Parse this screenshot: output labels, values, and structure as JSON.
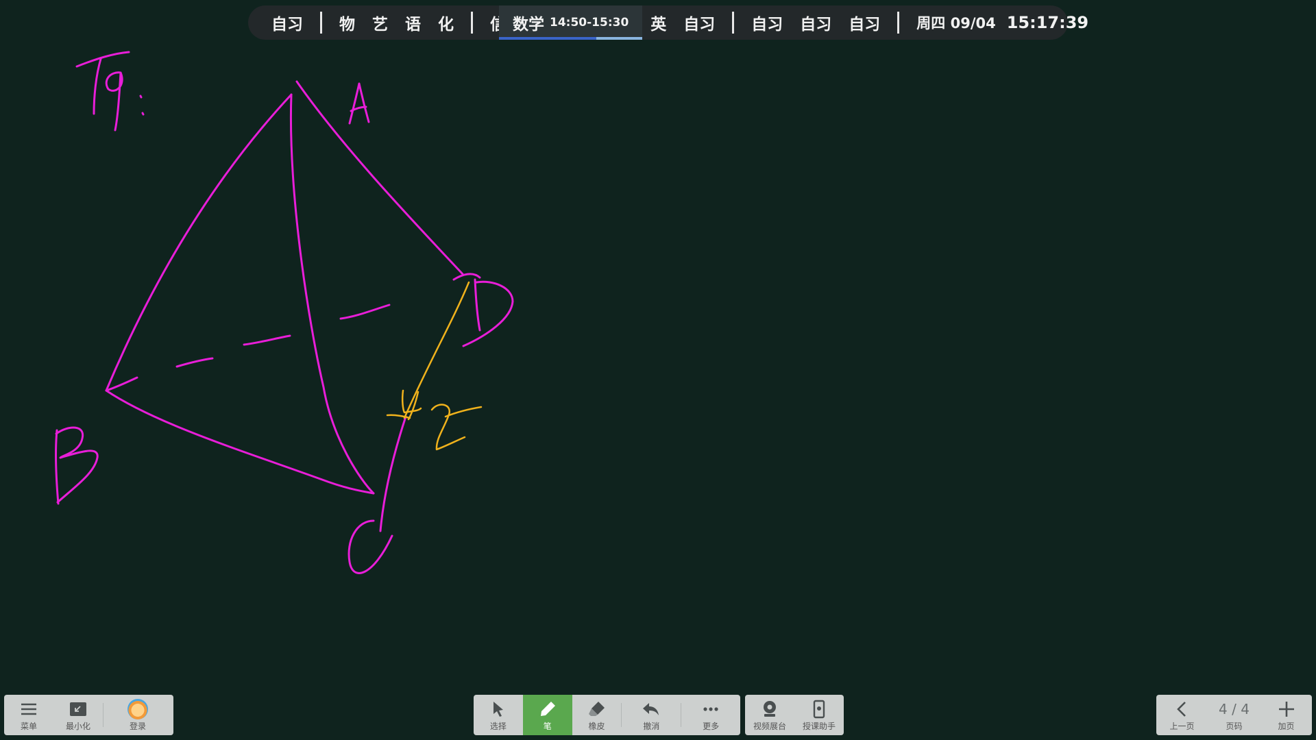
{
  "schedule": {
    "items_before": [
      "自习"
    ],
    "group1": [
      "物",
      "艺",
      "语",
      "化"
    ],
    "group2": [
      "信"
    ],
    "current": {
      "subject": "数学",
      "time": "14:50-15:30",
      "progress": 0.68
    },
    "group3": [
      "英",
      "自习"
    ],
    "group4": [
      "自习",
      "自习",
      "自习"
    ],
    "date": "周四 09/04",
    "clock": "15:17:39"
  },
  "canvas": {
    "ink_colors": {
      "magenta": "#e81ed8",
      "orange": "#f0b21c"
    },
    "handwriting": "T9: A B C D 42"
  },
  "left_toolbar": {
    "menu": {
      "label": "菜单",
      "icon": "hamburger-icon"
    },
    "minimize": {
      "label": "最小化",
      "icon": "minimize-icon"
    },
    "login": {
      "label": "登录",
      "icon": "avatar-icon"
    }
  },
  "center_toolbar": {
    "select": {
      "label": "选择",
      "icon": "cursor-arrow-icon"
    },
    "pen": {
      "label": "笔",
      "icon": "pen-icon"
    },
    "eraser": {
      "label": "橡皮",
      "icon": "eraser-icon"
    },
    "undo": {
      "label": "撤消",
      "icon": "undo-icon"
    },
    "more": {
      "label": "更多",
      "icon": "more-dots-icon"
    }
  },
  "aux_toolbar": {
    "visualizer": {
      "label": "视频展台",
      "icon": "webcam-icon"
    },
    "assistant": {
      "label": "授课助手",
      "icon": "phone-assistant-icon"
    }
  },
  "right_toolbar": {
    "prev": {
      "label": "上一页",
      "icon": "chevron-left-icon"
    },
    "page": {
      "label": "页码",
      "value": "4 / 4"
    },
    "add": {
      "label": "加页",
      "icon": "plus-icon"
    }
  },
  "colors": {
    "board": "#0f231e",
    "active_tool": "#5aa84e",
    "toolbar": "#cdd0cf"
  }
}
